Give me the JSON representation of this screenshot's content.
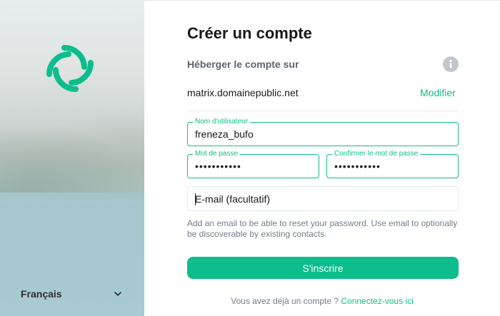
{
  "left": {
    "logo_icon": "element-logo-icon",
    "language": {
      "selected": "Français",
      "icon": "chevron-down-icon"
    }
  },
  "form": {
    "title": "Créer un compte",
    "host_heading": "Héberger le compte sur",
    "info_icon": "info-icon",
    "server": "matrix.domainepublic.net",
    "modify_label": "Modifier",
    "username": {
      "label": "Nom d'utilisateur",
      "value": "freneza_bufo"
    },
    "password": {
      "label": "Mot de passe",
      "value": "•••••••••••"
    },
    "confirm_password": {
      "label": "Confirmer le mot de passe",
      "value": "•••••••••••"
    },
    "email": {
      "placeholder": "E-mail (facultatif)",
      "value": ""
    },
    "help_text": "Add an email to be able to reset your password. Use email to optionally be discoverable by existing contacts.",
    "submit_label": "S'inscrire",
    "footer_question": "Vous avez déjà un compte ?",
    "footer_link": "Connectez-vous ici"
  },
  "colors": {
    "accent": "#0dbd8b",
    "text_primary": "#17191c",
    "text_secondary": "#737d8c",
    "border": "#e3e8f0"
  }
}
